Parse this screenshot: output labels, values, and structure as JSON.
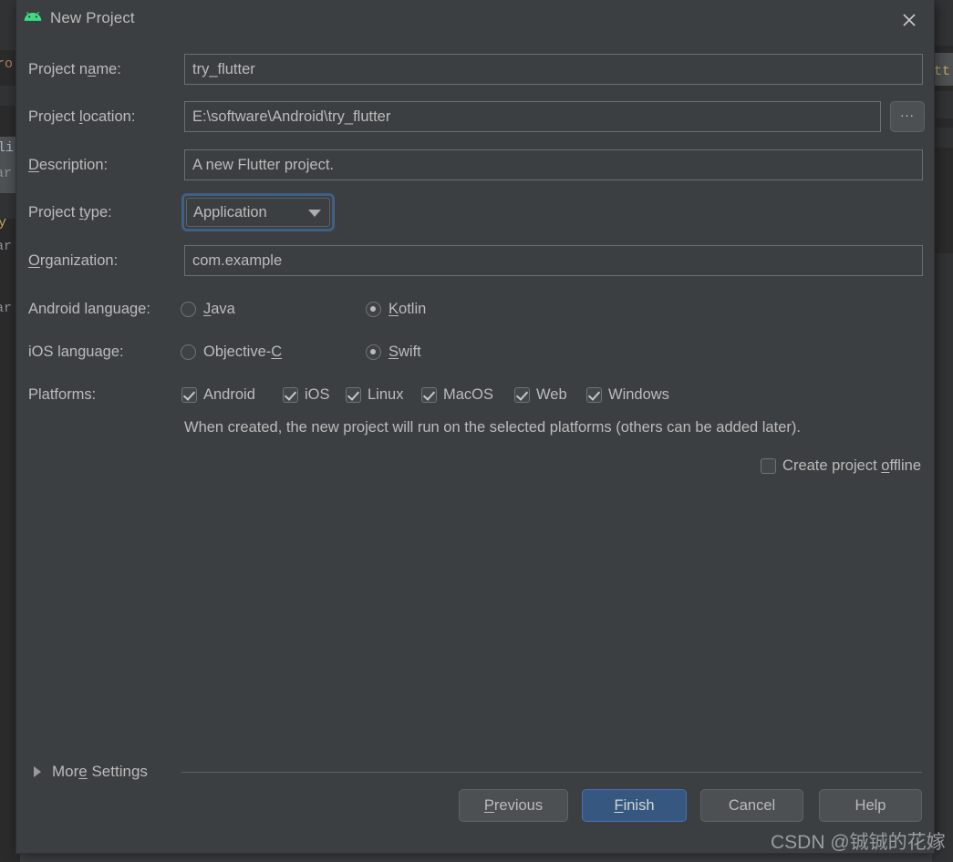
{
  "window": {
    "title": "New Project",
    "icon": "android-robot-icon",
    "close_label": "✕",
    "accent_blue": "#3d6185",
    "primary_button_bg": "#365880",
    "dialog_bg": "#3c3f41",
    "text_color": "#bbbbbb"
  },
  "form": {
    "project_name": {
      "label_pre": "Project n",
      "label_mnemonic": "a",
      "label_post": "me:",
      "value": "try_flutter"
    },
    "project_location": {
      "label_pre": "Project ",
      "label_mnemonic": "l",
      "label_post": "ocation:",
      "value": "E:\\software\\Android\\try_flutter",
      "browse_label": "..."
    },
    "description": {
      "label_pre": "",
      "label_mnemonic": "D",
      "label_post": "escription:",
      "value": "A new Flutter project."
    },
    "project_type": {
      "label_pre": "Project ",
      "label_mnemonic": "t",
      "label_post": "ype:",
      "value": "Application",
      "options": [
        "Application"
      ]
    },
    "organization": {
      "label_pre": "",
      "label_mnemonic": "O",
      "label_post": "rganization:",
      "value": "com.example"
    },
    "android_language": {
      "label": "Android language:",
      "options": [
        {
          "label_pre": "",
          "label_mnemonic": "J",
          "label_post": "ava",
          "selected": false
        },
        {
          "label_pre": "",
          "label_mnemonic": "K",
          "label_post": "otlin",
          "selected": true
        }
      ]
    },
    "ios_language": {
      "label": "iOS language:",
      "options": [
        {
          "label_pre": "Objective-",
          "label_mnemonic": "C",
          "label_post": "",
          "selected": false
        },
        {
          "label_pre": "",
          "label_mnemonic": "S",
          "label_post": "wift",
          "selected": true
        }
      ]
    },
    "platforms": {
      "label": "Platforms:",
      "items": [
        {
          "label": "Android",
          "checked": true
        },
        {
          "label": "iOS",
          "checked": true
        },
        {
          "label": "Linux",
          "checked": true
        },
        {
          "label": "MacOS",
          "checked": true
        },
        {
          "label": "Web",
          "checked": true
        },
        {
          "label": "Windows",
          "checked": true
        }
      ],
      "helper_text": "When created, the new project will run on the selected platforms (others can be added later)."
    },
    "create_offline": {
      "label_pre": "Create project ",
      "label_mnemonic": "o",
      "label_post": "ffline",
      "checked": false
    }
  },
  "more_settings": {
    "label_pre": "Mor",
    "label_mnemonic": "e",
    "label_post": " Settings",
    "expanded": false
  },
  "buttons": {
    "previous": {
      "pre": "",
      "mnemonic": "P",
      "post": "revious"
    },
    "finish": {
      "pre": "",
      "mnemonic": "F",
      "post": "inish"
    },
    "cancel": {
      "pre": "Cancel",
      "mnemonic": "",
      "post": ""
    },
    "help": {
      "pre": "Help",
      "mnemonic": "",
      "post": ""
    }
  },
  "watermark": "CSDN @铖铖的花嫁",
  "background_editor": {
    "left_fragments": [
      "ro",
      "li",
      "ar",
      "y",
      "ar",
      "ar"
    ],
    "right_fragments": [
      "tt"
    ]
  }
}
